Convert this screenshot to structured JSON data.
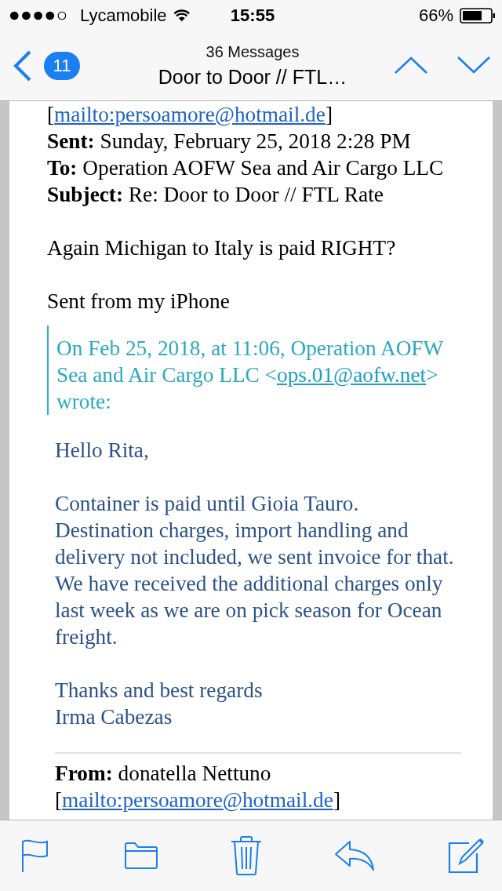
{
  "status_bar": {
    "carrier": "Lycamobile",
    "time": "15:55",
    "battery": "66%"
  },
  "nav": {
    "back_count": "11",
    "subtitle": "36 Messages",
    "title": "Door to Door // FTL…"
  },
  "message": {
    "header": [
      {
        "kind": "link_line",
        "before": "[",
        "link": "mailto:persoamore@hotmail.de",
        "after": "]"
      },
      {
        "kind": "field",
        "label": "Sent:",
        "value": "Sunday, February 25, 2018 2:28 PM"
      },
      {
        "kind": "field",
        "label": "To:",
        "value": "Operation AOFW Sea and Air Cargo LLC"
      },
      {
        "kind": "field",
        "label": "Subject:",
        "value": "Re: Door to Door // FTL Rate"
      }
    ],
    "paragraphs": [
      "Again Michigan to Italy is paid RIGHT?",
      "Sent from my iPhone"
    ],
    "quote": {
      "before": "On Feb 25, 2018, at 11:06, Operation AOFW Sea and Air Cargo LLC <",
      "link": "ops.01@aofw.net",
      "after": "> wrote:"
    },
    "quoted_paragraphs": [
      [
        "Hello Rita,"
      ],
      [
        "Container is paid until Gioia Tauro. Destination charges, import handling and delivery not included, we sent invoice for that. We have received the additional charges only last week as we are on pick season for Ocean freight."
      ],
      [
        "Thanks and best regards",
        "Irma Cabezas"
      ]
    ],
    "forwarded": [
      {
        "kind": "field",
        "label": "From:",
        "value": "donatella Nettuno"
      },
      {
        "kind": "link_line",
        "before": "[",
        "link": "mailto:persoamore@hotmail.de",
        "after": "]"
      }
    ]
  }
}
